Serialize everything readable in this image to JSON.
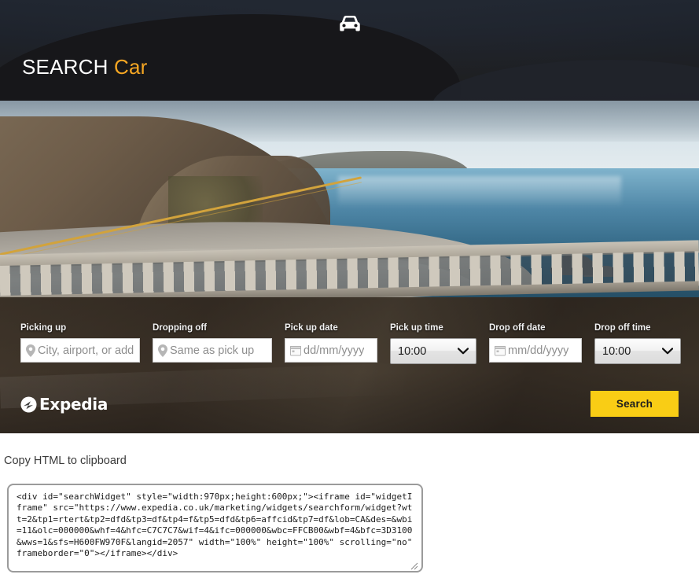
{
  "widget": {
    "car_icon": "car-front-icon",
    "title_main": "SEARCH",
    "title_accent": "Car",
    "fields": [
      {
        "key": "picking_up",
        "label": "Picking up",
        "placeholder": "City, airport, or address",
        "value": "",
        "icon": "location-pin-icon",
        "type": "text"
      },
      {
        "key": "dropping_off",
        "label": "Dropping off",
        "placeholder": "Same as pick up",
        "value": "",
        "icon": "location-pin-icon",
        "type": "text"
      },
      {
        "key": "pick_up_date",
        "label": "Pick up date",
        "placeholder": "dd/mm/yyyy",
        "value": "",
        "icon": "calendar-icon",
        "type": "date"
      },
      {
        "key": "pick_up_time",
        "label": "Pick up time",
        "value": "10:00",
        "icon": "chevron-down-icon",
        "type": "select"
      },
      {
        "key": "drop_off_date",
        "label": "Drop off date",
        "placeholder": "mm/dd/yyyy",
        "value": "",
        "icon": "calendar-icon",
        "type": "date"
      },
      {
        "key": "drop_off_time",
        "label": "Drop off time",
        "value": "10:00",
        "icon": "chevron-down-icon",
        "type": "select"
      }
    ],
    "brand": "Expedia",
    "brand_icon": "expedia-logo-icon",
    "search_button": "Search",
    "colors": {
      "accent_yellow": "#f5a623",
      "button_yellow": "#f9cd15",
      "button_text": "#1d1d1d",
      "header_dark": "#232a35"
    }
  },
  "copy_section": {
    "label": "Copy HTML to clipboard",
    "code": "<div id=\"searchWidget\" style=\"width:970px;height:600px;\"><iframe id=\"widgetIframe\" src=\"https://www.expedia.co.uk/marketing/widgets/searchform/widget?wtt=2&tp1=rtert&tp2=dfd&tp3=df&tp4=f&tp5=dfd&tp6=affcid&tp7=df&lob=CA&des=&wbi=11&olc=000000&whf=4&hfc=C7C7C7&wif=4&ifc=000000&wbc=FFCB00&wbf=4&bfc=3D3100&wws=1&sfs=H600FW970F&langid=2057\" width=\"100%\" height=\"100%\" scrolling=\"no\" frameborder=\"0\"></iframe></div>"
  }
}
